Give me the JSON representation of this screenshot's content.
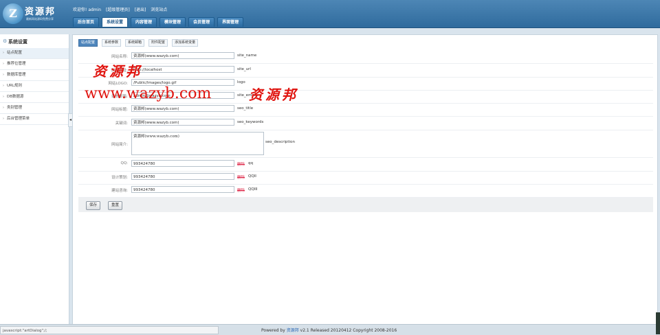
{
  "header": {
    "logo_mark": "Z",
    "logo_text": "资源邦",
    "logo_sub": "最新网站源码免费分享",
    "welcome": "欢迎你! admin",
    "role": "[超级管理员]",
    "logout": "[退出]",
    "browse": "浏览站点",
    "tabs": [
      "后台首页",
      "系统设置",
      "内容管理",
      "模块管理",
      "会员管理",
      "界面管理"
    ],
    "active_tab": "系统设置"
  },
  "sidebar": {
    "title": "系统设置",
    "items": [
      "站点配置",
      "推荐位管理",
      "数据库管理",
      "URL规则",
      "DB数据源",
      "类别管理",
      "后台管理菜单"
    ],
    "active_item": "站点配置"
  },
  "subtabs": [
    "站点配置",
    "系统参数",
    "系统邮箱",
    "附件配置",
    "添加系统变量"
  ],
  "form": {
    "rows": [
      {
        "label": "网站名称:",
        "value": "资源邦(www.wazyb.com)",
        "key": "site_name"
      },
      {
        "label": "网站网址:",
        "value": "http://localhost",
        "key": "site_url"
      },
      {
        "label": "网站LOGO:",
        "value": "/Public/Images/logo.gif",
        "key": "logo"
      },
      {
        "label": "站长邮箱:",
        "value": "admin@wazyb.com",
        "key": "site_email"
      },
      {
        "label": "网站标题:",
        "value": "资源邦(www.wazyb.com)",
        "key": "seo_title"
      },
      {
        "label": "关键词:",
        "value": "资源邦(www.wazyb.com)",
        "key": "seo_keywords"
      },
      {
        "label": "网站简介:",
        "value": "资源邦(www.wazyb.com)",
        "key": "seo_description"
      },
      {
        "label": "QQ:",
        "value": "993424780",
        "key": "qq",
        "delete": "删除"
      },
      {
        "label": "设计策划:",
        "value": "993424780",
        "key": "QQII",
        "delete": "删除"
      },
      {
        "label": "建站咨询:",
        "value": "993424780",
        "key": "QQIII",
        "delete": "删除"
      }
    ],
    "save": "保存",
    "reset": "重置"
  },
  "watermark": {
    "url": "www.wazyb.com",
    "chinese": "资源邦"
  },
  "footer": {
    "status": "javascript:\"artDialog\";/;",
    "powered_by": "Powered by",
    "brand": "资源邦",
    "release": "v2.1 Released 20120412 Copyright 2008-2016"
  },
  "colors": {
    "header": "#3a77aa",
    "accent": "#4f86bc",
    "watermark": "#e0140f"
  }
}
